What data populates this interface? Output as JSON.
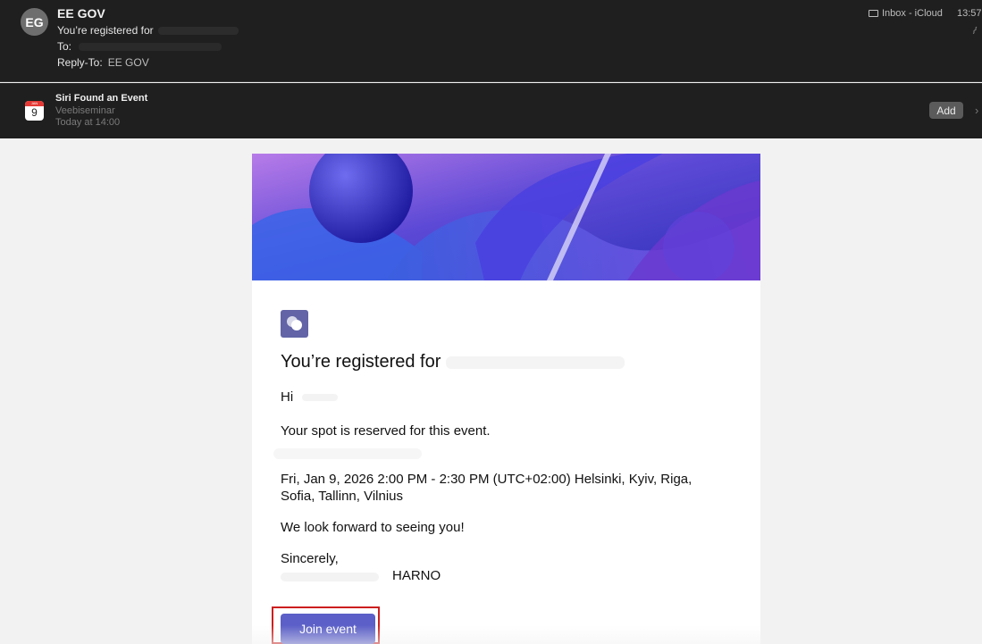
{
  "header": {
    "avatar_initials": "EG",
    "sender": "EE GOV",
    "subject_prefix": "You’re registered for",
    "to_label": "To:",
    "reply_to_label": "Reply-To:",
    "reply_to_value": "EE GOV",
    "mailbox": "Inbox - iCloud",
    "time": "13:57"
  },
  "siri": {
    "calendar_month": "JAN",
    "calendar_day": "9",
    "title": "Siri Found an Event",
    "event_name": "Veebiseminar",
    "when": "Today at 14:00",
    "add_label": "Add"
  },
  "email": {
    "heading": "You’re registered for",
    "greeting": "Hi",
    "reserved": "Your spot is reserved for this event.",
    "datetime": "Fri, Jan 9, 2026 2:00 PM - 2:30 PM (UTC+02:00) Helsinki, Kyiv, Riga, Sofia, Tallinn, Vilnius",
    "look_forward": "We look forward to seeing you!",
    "sincerely": "Sincerely,",
    "signature": "HARNO",
    "join_label": "Join event"
  },
  "colors": {
    "header_bg": "#1f1f1f",
    "teams_purple": "#6264a7",
    "join_button": "#5b5fc7",
    "highlight_border": "#cc1f1f"
  }
}
